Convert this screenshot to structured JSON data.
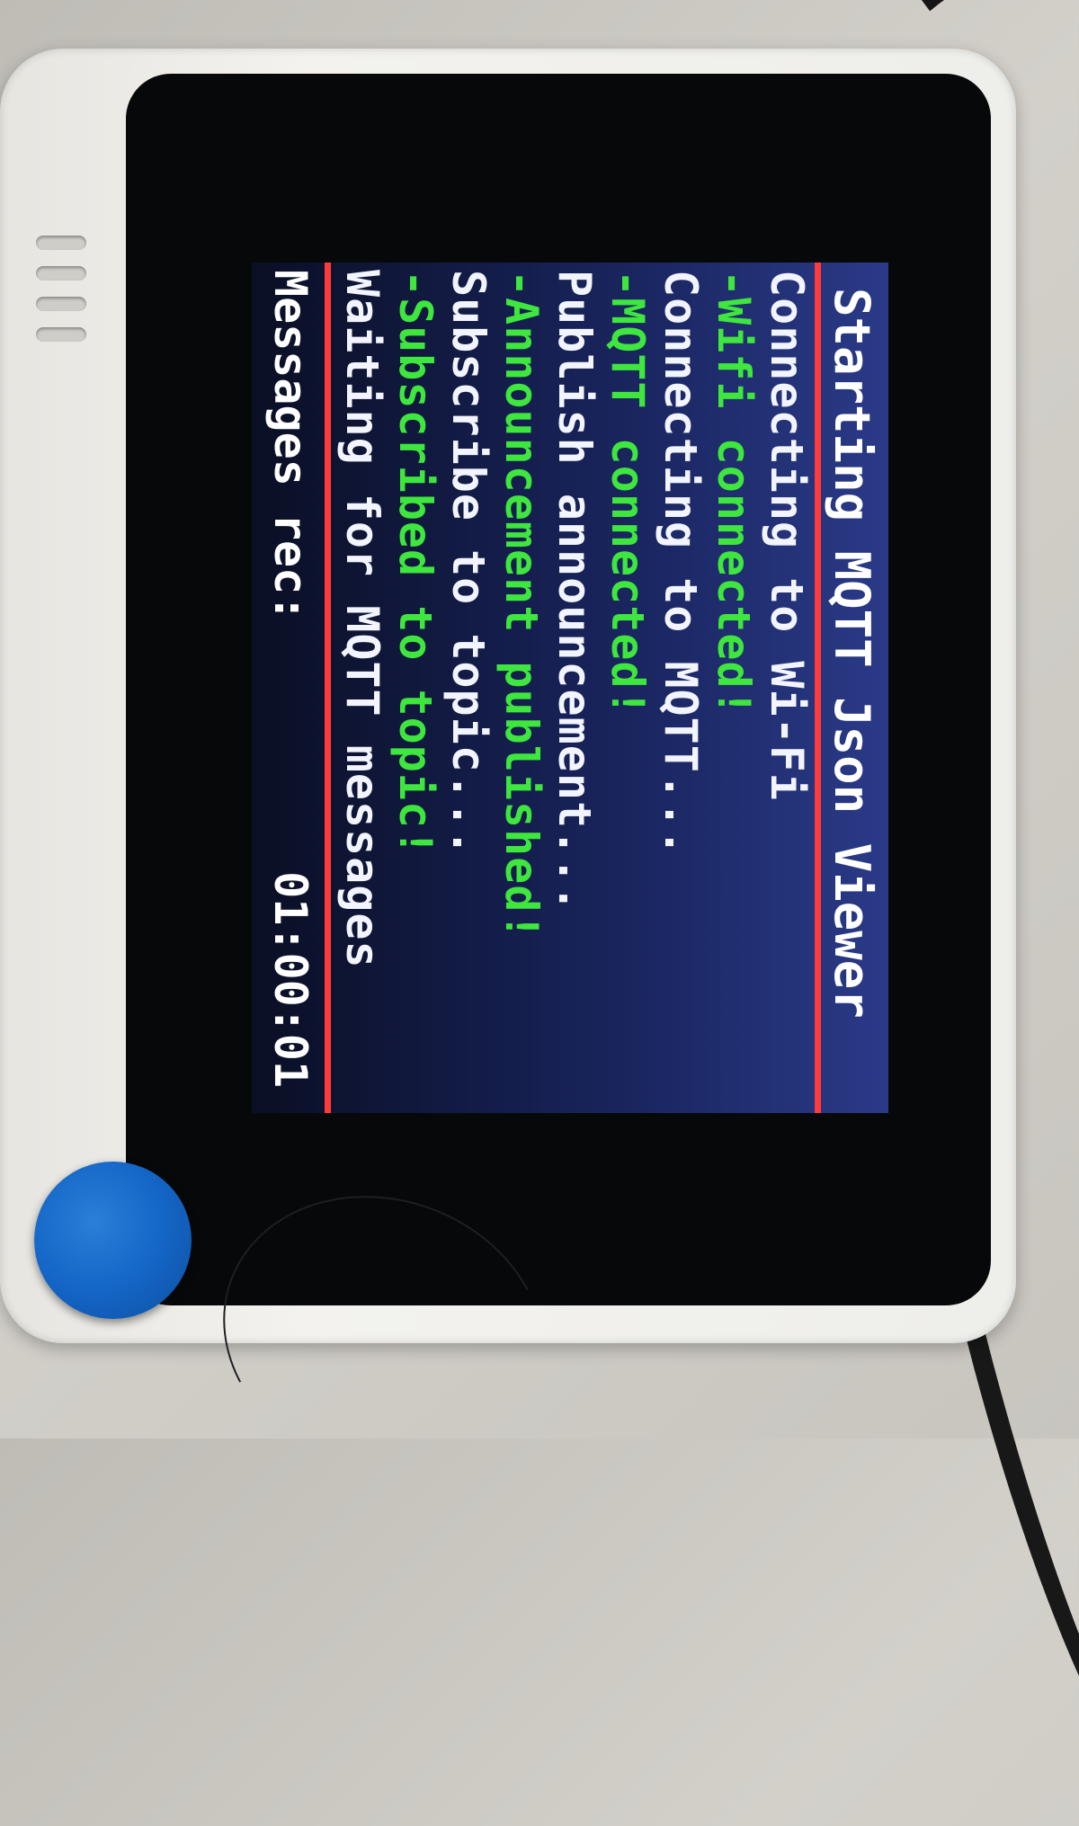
{
  "screen": {
    "title": "Starting MQTT Json Viewer",
    "log": [
      {
        "text": "Connecting to Wi-Fi",
        "color": "white"
      },
      {
        "text": "-Wifi connected!",
        "color": "green"
      },
      {
        "text": "Connecting to MQTT...",
        "color": "white"
      },
      {
        "text": "-MQTT connected!",
        "color": "green"
      },
      {
        "text": "Publish announcement...",
        "color": "white"
      },
      {
        "text": "-Announcement published!",
        "color": "green"
      },
      {
        "text": "Subscribe to topic...",
        "color": "white"
      },
      {
        "text": "-Subscribed to topic!",
        "color": "green"
      },
      {
        "text": "Waiting for MQTT messages",
        "color": "white"
      }
    ],
    "footer": {
      "label": "Messages rec:",
      "time": "01:00:01"
    }
  },
  "colors": {
    "background": "#1a2460",
    "divider": "#ff3a3a",
    "status_ok": "#3ee63e",
    "text": "#ffffff",
    "knob": "#1466c7"
  }
}
